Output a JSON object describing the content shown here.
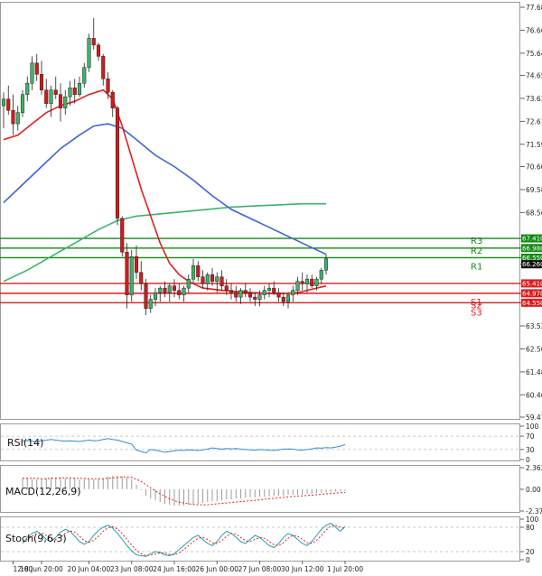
{
  "chart_data": {
    "type": "candlestick",
    "main": {
      "y_ticks": [
        "77.680",
        "76.660",
        "75.640",
        "74.650",
        "73.630",
        "72.610",
        "71.590",
        "70.600",
        "69.580",
        "68.560",
        "67.410",
        "66.980",
        "66.550",
        "66.260",
        "65.410",
        "64.970",
        "64.550",
        "63.520",
        "62.500",
        "61.480",
        "60.460",
        "59.470"
      ],
      "ylim": [
        59.47,
        77.68
      ],
      "levels": [
        {
          "name": "R3",
          "value": 67.41,
          "color": "#138a13",
          "tag": "67.410"
        },
        {
          "name": "R2",
          "value": 66.98,
          "color": "#138a13",
          "tag": "66.980"
        },
        {
          "name": "R1",
          "value": 66.55,
          "color": "#138a13",
          "tag": "66.550"
        },
        {
          "name": "",
          "value": 65.41,
          "color": "#e01b1b",
          "tag": "65.410"
        },
        {
          "name": "S1",
          "value": 64.97,
          "color": "#e01b1b",
          "tag": "64.970"
        },
        {
          "name": "S2",
          "value": 64.55,
          "color": "#e01b1b",
          "tag": "64.550"
        },
        {
          "name": "S3",
          "value": 64.55,
          "color": "#e01b1b",
          "tag": ""
        }
      ],
      "current_price": {
        "value": 66.26,
        "tag": "66.260",
        "color": "#111111"
      },
      "candles": [
        [
          73.3,
          73.9,
          72.3,
          73.6
        ],
        [
          73.6,
          74.2,
          72.9,
          73.1
        ],
        [
          73.1,
          73.8,
          72.0,
          72.5
        ],
        [
          72.5,
          73.3,
          72.2,
          73.0
        ],
        [
          73.0,
          74.0,
          72.8,
          73.8
        ],
        [
          73.8,
          74.6,
          73.5,
          74.3
        ],
        [
          74.3,
          75.5,
          74.0,
          75.2
        ],
        [
          75.2,
          75.6,
          74.4,
          74.7
        ],
        [
          74.7,
          75.3,
          73.8,
          74.0
        ],
        [
          74.0,
          74.5,
          73.2,
          73.4
        ],
        [
          73.4,
          74.2,
          72.8,
          74.0
        ],
        [
          74.0,
          74.6,
          73.6,
          73.8
        ],
        [
          73.8,
          74.3,
          72.6,
          73.2
        ],
        [
          73.2,
          74.0,
          72.9,
          73.7
        ],
        [
          73.7,
          74.4,
          73.3,
          74.1
        ],
        [
          74.1,
          74.5,
          73.4,
          73.8
        ],
        [
          73.8,
          74.6,
          73.7,
          74.3
        ],
        [
          74.3,
          75.2,
          74.1,
          75.0
        ],
        [
          75.0,
          76.5,
          74.8,
          76.3
        ],
        [
          76.3,
          77.2,
          75.8,
          76.0
        ],
        [
          76.0,
          76.1,
          75.3,
          75.5
        ],
        [
          75.5,
          75.6,
          74.2,
          74.5
        ],
        [
          74.5,
          74.8,
          73.6,
          73.9
        ],
        [
          73.9,
          74.0,
          72.8,
          73.2
        ],
        [
          73.2,
          73.3,
          68.0,
          68.3
        ],
        [
          68.3,
          68.4,
          66.6,
          66.8
        ],
        [
          66.8,
          67.2,
          64.3,
          64.9
        ],
        [
          64.9,
          66.9,
          64.6,
          66.6
        ],
        [
          66.6,
          67.1,
          65.6,
          65.9
        ],
        [
          65.9,
          66.4,
          65.1,
          65.4
        ],
        [
          65.4,
          65.6,
          64.0,
          64.3
        ],
        [
          64.3,
          64.9,
          64.1,
          64.7
        ],
        [
          64.7,
          65.2,
          64.4,
          65.0
        ],
        [
          65.0,
          65.3,
          64.6,
          65.2
        ],
        [
          65.2,
          65.5,
          64.8,
          65.0
        ],
        [
          65.0,
          65.4,
          64.6,
          65.3
        ],
        [
          65.3,
          65.6,
          64.8,
          65.1
        ],
        [
          65.1,
          65.4,
          64.7,
          64.9
        ],
        [
          64.9,
          65.3,
          64.6,
          65.2
        ],
        [
          65.2,
          65.8,
          65.0,
          65.6
        ],
        [
          65.6,
          66.5,
          65.4,
          66.2
        ],
        [
          66.2,
          66.4,
          65.5,
          65.7
        ],
        [
          65.7,
          66.0,
          65.2,
          65.4
        ],
        [
          65.4,
          65.9,
          65.1,
          65.8
        ],
        [
          65.8,
          66.1,
          65.3,
          65.5
        ],
        [
          65.5,
          65.9,
          65.0,
          65.7
        ],
        [
          65.7,
          66.0,
          65.1,
          65.3
        ],
        [
          65.3,
          65.6,
          64.9,
          65.1
        ],
        [
          65.1,
          65.4,
          64.7,
          65.0
        ],
        [
          65.0,
          65.3,
          64.6,
          64.8
        ],
        [
          64.8,
          65.2,
          64.5,
          65.1
        ],
        [
          65.1,
          65.4,
          64.8,
          65.0
        ],
        [
          65.0,
          65.2,
          64.6,
          64.8
        ],
        [
          64.8,
          65.0,
          64.4,
          64.7
        ],
        [
          64.7,
          65.1,
          64.4,
          64.9
        ],
        [
          64.9,
          65.3,
          64.7,
          65.1
        ],
        [
          65.1,
          65.4,
          64.8,
          65.2
        ],
        [
          65.2,
          65.5,
          64.9,
          65.0
        ],
        [
          65.0,
          65.2,
          64.6,
          64.8
        ],
        [
          64.8,
          65.0,
          64.4,
          64.6
        ],
        [
          64.6,
          65.0,
          64.3,
          64.9
        ],
        [
          64.9,
          65.3,
          64.6,
          65.1
        ],
        [
          65.1,
          65.7,
          64.9,
          65.5
        ],
        [
          65.5,
          65.9,
          65.1,
          65.4
        ],
        [
          65.4,
          65.8,
          65.0,
          65.6
        ],
        [
          65.6,
          65.8,
          65.2,
          65.3
        ],
        [
          65.3,
          65.7,
          65.1,
          65.6
        ],
        [
          65.6,
          66.1,
          65.4,
          66.0
        ],
        [
          66.0,
          66.7,
          65.8,
          66.5
        ]
      ],
      "ma_fast": [
        [
          0,
          71.8
        ],
        [
          3,
          72.0
        ],
        [
          6,
          72.5
        ],
        [
          9,
          73.0
        ],
        [
          12,
          73.3
        ],
        [
          15,
          73.5
        ],
        [
          18,
          73.8
        ],
        [
          21,
          74.0
        ],
        [
          23,
          73.6
        ],
        [
          25,
          72.4
        ],
        [
          27,
          71.0
        ],
        [
          29,
          69.6
        ],
        [
          31,
          68.4
        ],
        [
          33,
          67.2
        ],
        [
          35,
          66.3
        ],
        [
          37,
          65.8
        ],
        [
          39,
          65.5
        ],
        [
          42,
          65.2
        ],
        [
          46,
          65.1
        ],
        [
          52,
          65.0
        ],
        [
          58,
          64.95
        ],
        [
          62,
          65.0
        ],
        [
          65,
          65.15
        ],
        [
          68,
          65.3
        ]
      ],
      "ma_mid": [
        [
          0,
          69.0
        ],
        [
          4,
          69.8
        ],
        [
          8,
          70.6
        ],
        [
          12,
          71.4
        ],
        [
          16,
          72.0
        ],
        [
          19,
          72.4
        ],
        [
          22,
          72.5
        ],
        [
          25,
          72.3
        ],
        [
          28,
          71.8
        ],
        [
          32,
          71.1
        ],
        [
          36,
          70.6
        ],
        [
          40,
          70.0
        ],
        [
          44,
          69.3
        ],
        [
          48,
          68.7
        ],
        [
          52,
          68.3
        ],
        [
          56,
          67.9
        ],
        [
          60,
          67.5
        ],
        [
          64,
          67.1
        ],
        [
          68,
          66.7
        ]
      ],
      "ma_slow": [
        [
          0,
          65.5
        ],
        [
          5,
          66.0
        ],
        [
          10,
          66.6
        ],
        [
          15,
          67.2
        ],
        [
          20,
          67.8
        ],
        [
          24,
          68.2
        ],
        [
          28,
          68.4
        ],
        [
          33,
          68.5
        ],
        [
          38,
          68.6
        ],
        [
          43,
          68.7
        ],
        [
          48,
          68.8
        ],
        [
          53,
          68.85
        ],
        [
          58,
          68.9
        ],
        [
          63,
          68.95
        ],
        [
          68,
          68.95
        ]
      ]
    },
    "x_ticks": [
      {
        "label": "12:00",
        "i": 2
      },
      {
        "label": "18 Jun 20:00",
        "i": 8
      },
      {
        "label": "20 Jun 04:00",
        "i": 18
      },
      {
        "label": "23 Jun 08:00",
        "i": 27
      },
      {
        "label": "24 Jun 16:00",
        "i": 36
      },
      {
        "label": "26 Jun 00:00",
        "i": 45
      },
      {
        "label": "27 Jun 08:00",
        "i": 54
      },
      {
        "label": "30 Jun 12:00",
        "i": 63
      },
      {
        "label": "1 Jul 20:00",
        "i": 72
      }
    ],
    "rsi": {
      "title": "RSI(14)",
      "y_ticks": [
        "100",
        "70",
        "30",
        "0"
      ],
      "ylim": [
        0,
        100
      ],
      "values": [
        55,
        57,
        55,
        53,
        56,
        58,
        60,
        58,
        56,
        55,
        56,
        55,
        54,
        56,
        58,
        56,
        57,
        60,
        63,
        60,
        58,
        54,
        50,
        46,
        28,
        24,
        20,
        30,
        28,
        25,
        22,
        24,
        26,
        28,
        27,
        29,
        28,
        27,
        29,
        31,
        35,
        33,
        31,
        33,
        32,
        33,
        31,
        30,
        29,
        28,
        30,
        29,
        28,
        27,
        29,
        31,
        32,
        31,
        29,
        28,
        30,
        32,
        35,
        34,
        36,
        35,
        37,
        40,
        45
      ]
    },
    "macd": {
      "title": "MACD(12,26,9)",
      "y_ticks": [
        "2.3621",
        "0.00",
        "-2.3797"
      ],
      "ylim": [
        -2.3797,
        2.3621
      ],
      "hist": [
        1.2,
        1.2,
        1.1,
        1.1,
        1.1,
        1.2,
        1.3,
        1.3,
        1.3,
        1.2,
        1.2,
        1.2,
        1.1,
        1.1,
        1.1,
        1.1,
        1.1,
        1.2,
        1.4,
        1.5,
        1.5,
        1.4,
        1.3,
        1.1,
        0.5,
        -0.1,
        -0.7,
        -1.0,
        -1.2,
        -1.4,
        -1.6,
        -1.7,
        -1.8,
        -1.8,
        -1.8,
        -1.7,
        -1.7,
        -1.6,
        -1.5,
        -1.4,
        -1.3,
        -1.3,
        -1.2,
        -1.1,
        -1.1,
        -1.0,
        -1.0,
        -0.9,
        -0.9,
        -0.9,
        -0.8,
        -0.8,
        -0.8,
        -0.7,
        -0.7,
        -0.7,
        -0.6,
        -0.6,
        -0.6,
        -0.6,
        -0.5,
        -0.5,
        -0.4,
        -0.4,
        -0.35,
        -0.3,
        -0.25,
        -0.2,
        -0.15
      ],
      "signal": [
        1.2,
        1.2,
        1.2,
        1.2,
        1.15,
        1.15,
        1.2,
        1.2,
        1.25,
        1.25,
        1.25,
        1.2,
        1.2,
        1.2,
        1.15,
        1.15,
        1.15,
        1.15,
        1.2,
        1.25,
        1.3,
        1.35,
        1.35,
        1.3,
        1.1,
        0.85,
        0.5,
        0.15,
        -0.2,
        -0.5,
        -0.8,
        -1.05,
        -1.25,
        -1.4,
        -1.5,
        -1.6,
        -1.65,
        -1.7,
        -1.7,
        -1.7,
        -1.65,
        -1.6,
        -1.55,
        -1.5,
        -1.45,
        -1.4,
        -1.35,
        -1.3,
        -1.25,
        -1.2,
        -1.15,
        -1.1,
        -1.05,
        -1.0,
        -0.95,
        -0.9,
        -0.85,
        -0.8,
        -0.75,
        -0.72,
        -0.68,
        -0.64,
        -0.6,
        -0.55,
        -0.5,
        -0.46,
        -0.42,
        -0.38,
        -0.34
      ]
    },
    "stoch": {
      "title": "Stoch(9,6,3)",
      "y_ticks": [
        "100",
        "80",
        "20",
        "0"
      ],
      "ylim": [
        0,
        100
      ],
      "k": [
        40,
        55,
        65,
        70,
        62,
        50,
        45,
        55,
        68,
        75,
        70,
        58,
        45,
        38,
        45,
        60,
        72,
        80,
        85,
        78,
        65,
        50,
        35,
        22,
        12,
        10,
        8,
        15,
        20,
        18,
        12,
        10,
        15,
        25,
        35,
        45,
        55,
        60,
        50,
        40,
        35,
        45,
        60,
        70,
        65,
        55,
        45,
        40,
        50,
        60,
        55,
        45,
        35,
        30,
        40,
        55,
        65,
        60,
        50,
        40,
        35,
        45,
        60,
        75,
        85,
        90,
        80,
        70,
        82
      ],
      "d": [
        45,
        50,
        58,
        65,
        66,
        60,
        52,
        50,
        56,
        65,
        71,
        68,
        58,
        47,
        43,
        48,
        58,
        70,
        79,
        81,
        76,
        64,
        50,
        36,
        23,
        15,
        10,
        11,
        14,
        17,
        17,
        13,
        12,
        17,
        25,
        35,
        45,
        53,
        55,
        50,
        42,
        40,
        47,
        58,
        65,
        63,
        55,
        47,
        45,
        50,
        55,
        53,
        45,
        37,
        35,
        42,
        53,
        60,
        58,
        50,
        42,
        40,
        48,
        60,
        73,
        83,
        85,
        80,
        77
      ]
    }
  }
}
